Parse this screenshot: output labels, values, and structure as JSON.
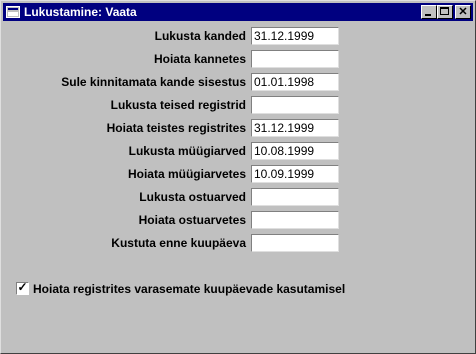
{
  "window": {
    "title": "Lukustamine: Vaata",
    "controls": {
      "minimize": "",
      "maximize": "",
      "close": "✕"
    }
  },
  "fields": [
    {
      "label": "Lukusta kanded",
      "value": "31.12.1999"
    },
    {
      "label": "Hoiata kannetes",
      "value": ""
    },
    {
      "label": "Sule kinnitamata kande sisestus",
      "value": "01.01.1998"
    },
    {
      "label": "Lukusta teised registrid",
      "value": ""
    },
    {
      "label": "Hoiata teistes registrites",
      "value": "31.12.1999"
    },
    {
      "label": "Lukusta müügiarved",
      "value": "10.08.1999"
    },
    {
      "label": "Hoiata müügiarvetes",
      "value": "10.09.1999"
    },
    {
      "label": "Lukusta ostuarved",
      "value": ""
    },
    {
      "label": "Hoiata ostuarvetes",
      "value": ""
    },
    {
      "label": "Kustuta enne kuupäeva",
      "value": ""
    }
  ],
  "option": {
    "label": "Hoiata registrites varasemate kuupäevade kasutamisel",
    "checked": true,
    "mark": "✓"
  }
}
